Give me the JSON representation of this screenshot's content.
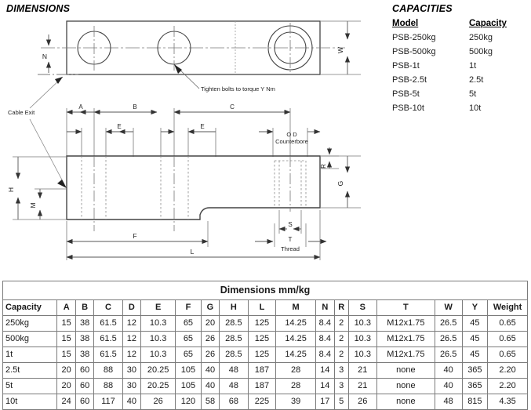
{
  "sections": {
    "dimensions_title": "DIMENSIONS",
    "capacities_title": "CAPACITIES"
  },
  "capacities": {
    "headers": [
      "Model",
      "Capacity"
    ],
    "rows": [
      [
        "PSB-250kg",
        "250kg"
      ],
      [
        "PSB-500kg",
        "500kg"
      ],
      [
        "PSB-1t",
        "1t"
      ],
      [
        "PSB-2.5t",
        "2.5t"
      ],
      [
        "PSB-5t",
        "5t"
      ],
      [
        "PSB-10t",
        "10t"
      ]
    ]
  },
  "drawing": {
    "labels": {
      "cable_exit": "Cable Exit",
      "torque_note": "Tighten bolts to torque Y Nm",
      "counterbore_od": "O D",
      "counterbore": "Counterbore",
      "thread": "Thread",
      "N": "N",
      "W": "W",
      "A": "A",
      "B": "B",
      "C": "C",
      "E1": "E",
      "E2": "E",
      "R": "R",
      "G": "G",
      "H": "H",
      "M": "M",
      "F": "F",
      "L": "L",
      "S": "S",
      "T": "T"
    },
    "colors": {
      "outline": "#444444",
      "dimension": "#555555",
      "hidden": "#777777"
    }
  },
  "table": {
    "title": "Dimensions mm/kg",
    "headers": [
      "Capacity",
      "A",
      "B",
      "C",
      "D",
      "E",
      "F",
      "G",
      "H",
      "L",
      "M",
      "N",
      "R",
      "S",
      "T",
      "W",
      "Y",
      "Weight"
    ],
    "rows": [
      [
        "250kg",
        "15",
        "38",
        "61.5",
        "12",
        "10.3",
        "65",
        "20",
        "28.5",
        "125",
        "14.25",
        "8.4",
        "2",
        "10.3",
        "M12x1.75",
        "26.5",
        "45",
        "0.65"
      ],
      [
        "500kg",
        "15",
        "38",
        "61.5",
        "12",
        "10.3",
        "65",
        "26",
        "28.5",
        "125",
        "14.25",
        "8.4",
        "2",
        "10.3",
        "M12x1.75",
        "26.5",
        "45",
        "0.65"
      ],
      [
        "1t",
        "15",
        "38",
        "61.5",
        "12",
        "10.3",
        "65",
        "26",
        "28.5",
        "125",
        "14.25",
        "8.4",
        "2",
        "10.3",
        "M12x1.75",
        "26.5",
        "45",
        "0.65"
      ],
      [
        "2.5t",
        "20",
        "60",
        "88",
        "30",
        "20.25",
        "105",
        "40",
        "48",
        "187",
        "28",
        "14",
        "3",
        "21",
        "none",
        "40",
        "365",
        "2.20"
      ],
      [
        "5t",
        "20",
        "60",
        "88",
        "30",
        "20.25",
        "105",
        "40",
        "48",
        "187",
        "28",
        "14",
        "3",
        "21",
        "none",
        "40",
        "365",
        "2.20"
      ],
      [
        "10t",
        "24",
        "60",
        "117",
        "40",
        "26",
        "120",
        "58",
        "68",
        "225",
        "39",
        "17",
        "5",
        "26",
        "none",
        "48",
        "815",
        "4.35"
      ]
    ]
  }
}
